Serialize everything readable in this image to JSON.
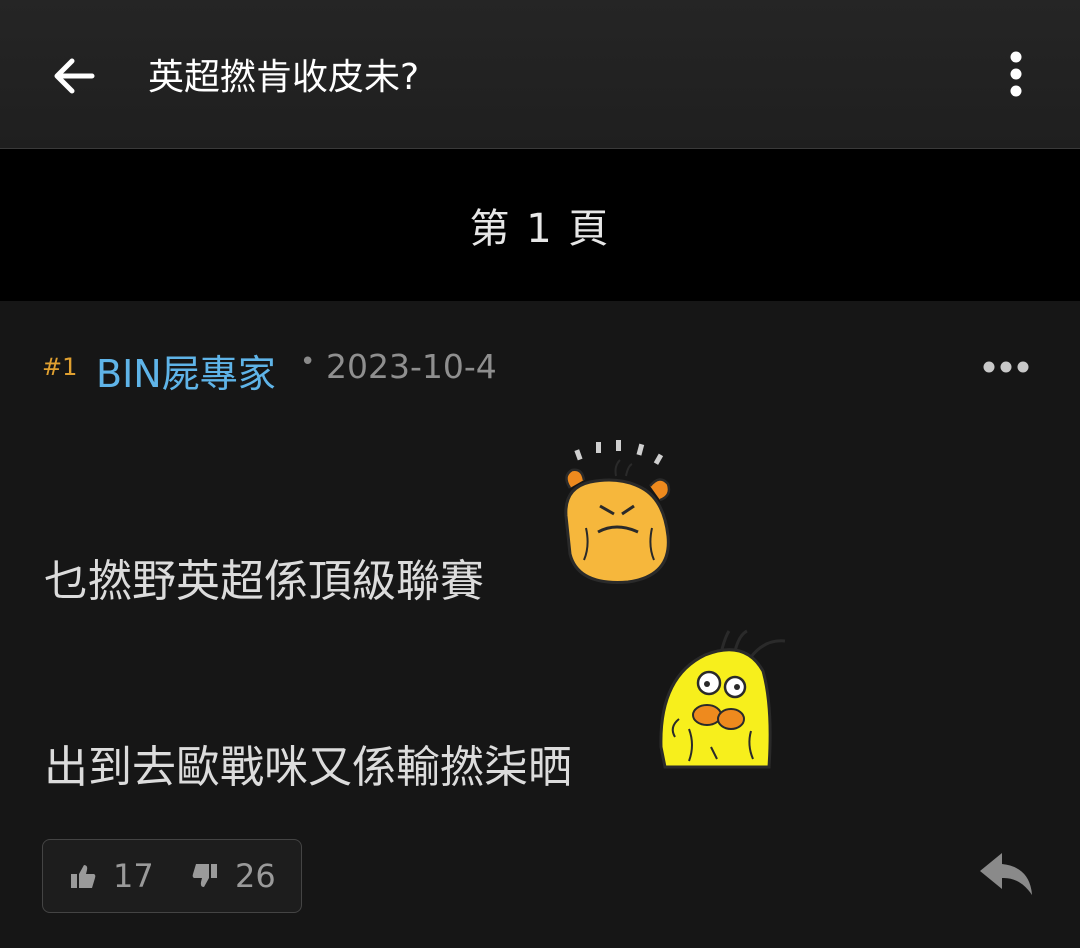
{
  "header": {
    "title": "英超撚肯收皮未?",
    "back_icon": "arrow-left-icon",
    "more_icon": "vertical-dots-icon"
  },
  "pagebar": {
    "label": "第 1 頁"
  },
  "post": {
    "number": "#1",
    "author": "BIN屍專家",
    "separator": "•",
    "date": "2023-10-4",
    "more_icon": "horizontal-dots-icon",
    "lines": [
      "乜撚野英超係頂級聯賽",
      "出到去歐戰咪又係輸撚柒晒"
    ],
    "stickers": [
      "frustrated-face-sticker",
      "worried-face-sticker"
    ],
    "votes": {
      "likes": "17",
      "dislikes": "26",
      "like_icon": "thumbs-up-icon",
      "dislike_icon": "thumbs-down-icon"
    },
    "reply_icon": "reply-arrow-icon"
  },
  "colors": {
    "author": "#5fb4e8",
    "post_number": "#e0a030",
    "background": "#161616",
    "pagebar": "#000000"
  }
}
